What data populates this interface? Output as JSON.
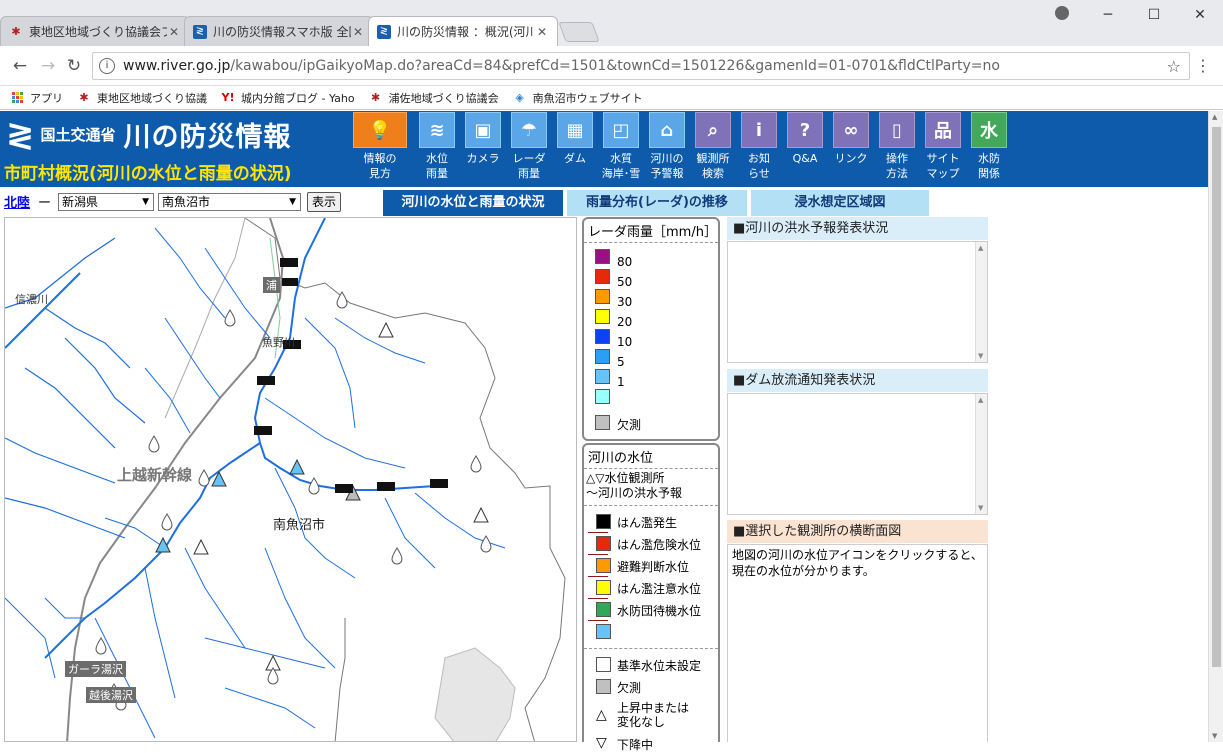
{
  "browser": {
    "tabs": [
      {
        "title": "東地区地域づくり協議会ブロ",
        "favicon": "red"
      },
      {
        "title": "川の防災情報スマホ版 全国",
        "favicon": "blue"
      },
      {
        "title": "川の防災情報 ：概況(河川",
        "favicon": "blue",
        "active": true
      }
    ],
    "url_host": "www.river.go.jp",
    "url_path": "/kawabou/ipGaikyoMap.do?areaCd=84&prefCd=1501&townCd=1501226&gamenId=01-0701&fldCtlParty=no",
    "bookmarks": [
      {
        "label": "アプリ",
        "icon": "apps-grid"
      },
      {
        "label": "東地区地域づくり協議",
        "icon": "red"
      },
      {
        "label": "城内分館ブログ - Yaho",
        "icon": "yahoo"
      },
      {
        "label": "浦佐地域づくり協議会",
        "icon": "red"
      },
      {
        "label": "南魚沼市ウェブサイト",
        "icon": "city"
      }
    ]
  },
  "header": {
    "agency": "国土交通省",
    "site_name": "川の防災情報",
    "subtitle": "市町村概況(河川の水位と雨量の状況)",
    "nav": [
      {
        "label": "情報の\n見方",
        "icon": "lightbulb-icon",
        "glyph": "💡"
      },
      {
        "label": "水位\n雨量",
        "icon": "water-level-icon",
        "glyph": "≋"
      },
      {
        "label": "カメラ",
        "icon": "camera-icon",
        "glyph": "▣"
      },
      {
        "label": "レーダ\n雨量",
        "icon": "radar-rain-icon",
        "glyph": "☂"
      },
      {
        "label": "ダム",
        "icon": "dam-icon",
        "glyph": "▦"
      },
      {
        "label": "水質\n海岸･雪",
        "icon": "water-quality-icon",
        "glyph": "◰"
      },
      {
        "label": "河川の\n予警報",
        "icon": "warning-house-icon",
        "glyph": "⌂"
      },
      {
        "label": "観測所\n検索",
        "icon": "magnifier-icon",
        "glyph": "⌕"
      },
      {
        "label": "お知\nらせ",
        "icon": "info-icon",
        "glyph": "i"
      },
      {
        "label": "Q&A",
        "icon": "question-icon",
        "glyph": "?"
      },
      {
        "label": "リンク",
        "icon": "link-icon",
        "glyph": "∞"
      },
      {
        "label": "操作\n方法",
        "icon": "mouse-icon",
        "glyph": "▯"
      },
      {
        "label": "サイト\nマップ",
        "icon": "sitemap-icon",
        "glyph": "品"
      },
      {
        "label": "水防\n関係",
        "icon": "flood-defense-icon",
        "glyph": "水"
      }
    ]
  },
  "controls": {
    "region_link": "北陸",
    "dash": "ー",
    "prefecture": "新潟県",
    "town": "南魚沼市",
    "show_button": "表示",
    "view_tabs": [
      {
        "label": "河川の水位と雨量の状況",
        "active": true
      },
      {
        "label": "雨量分布(レーダ)の推移",
        "active": false
      },
      {
        "label": "浸水想定区域図",
        "active": false
      }
    ]
  },
  "map": {
    "labels": {
      "shinano": "信濃川",
      "uoneno": "魚野川",
      "shinkansen": "上越新幹線",
      "city": "南魚沼市",
      "station_ura": "浦",
      "station_gala": "ガーラ湯沢",
      "station_echigo": "越後湯沢"
    }
  },
  "radar_legend": {
    "title": "レーダ雨量［mm/h］",
    "items": [
      {
        "label": "80",
        "color": "#9b0f84"
      },
      {
        "label": "50",
        "color": "#e52a0b"
      },
      {
        "label": "30",
        "color": "#ff9900"
      },
      {
        "label": "20",
        "color": "#ffff00"
      },
      {
        "label": "10",
        "color": "#0c42f1"
      },
      {
        "label": "5",
        "color": "#2b9ff3"
      },
      {
        "label": "1",
        "color": "#66c3f5"
      },
      {
        "label": "",
        "color": "#99ffff"
      }
    ],
    "missing": "欠測"
  },
  "level_legend": {
    "title": "河川の水位",
    "station_note": "水位観測所",
    "forecast_note": "河川の洪水予報",
    "items": [
      {
        "label": "はん濫発生",
        "color": "#000000"
      },
      {
        "label": "はん濫危険水位",
        "color": "#e52a0b"
      },
      {
        "label": "避難判断水位",
        "color": "#ff9900"
      },
      {
        "label": "はん濫注意水位",
        "color": "#ffff00"
      },
      {
        "label": "水防団待機水位",
        "color": "#2ea95a"
      },
      {
        "label": "",
        "color": "#66c3f5"
      }
    ],
    "not_set": "基準水位未設定",
    "missing": "欠測",
    "rising": "上昇中または\n変化なし",
    "falling": "下降中"
  },
  "panels": {
    "flood_forecast": "■河川の洪水予報発表状況",
    "dam_release": "■ダム放流通知発表状況",
    "cross_section": "■選択した観測所の横断面図",
    "cross_section_text": "地図の河川の水位アイコンをクリックすると、現在の水位が分かります。"
  }
}
